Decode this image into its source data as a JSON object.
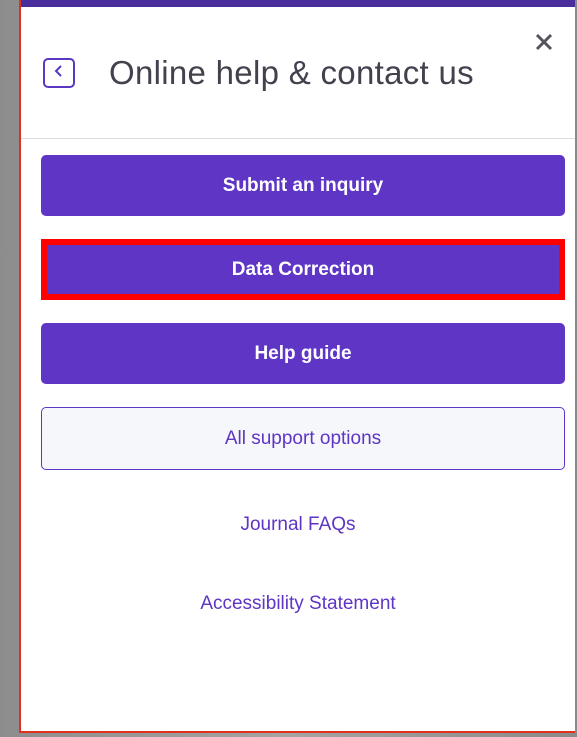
{
  "header": {
    "title": "Online help & contact us",
    "back_icon": "chevron-left-icon",
    "close_icon": "close-icon"
  },
  "buttons": {
    "submit_inquiry": "Submit an inquiry",
    "data_correction": "Data Correction",
    "help_guide": "Help guide",
    "all_support": "All support options"
  },
  "links": {
    "journal_faqs": "Journal FAQs",
    "accessibility": "Accessibility Statement"
  },
  "colors": {
    "accent": "#5e35c4",
    "highlight": "#ff0000",
    "top_strip": "#4a2f9c"
  }
}
